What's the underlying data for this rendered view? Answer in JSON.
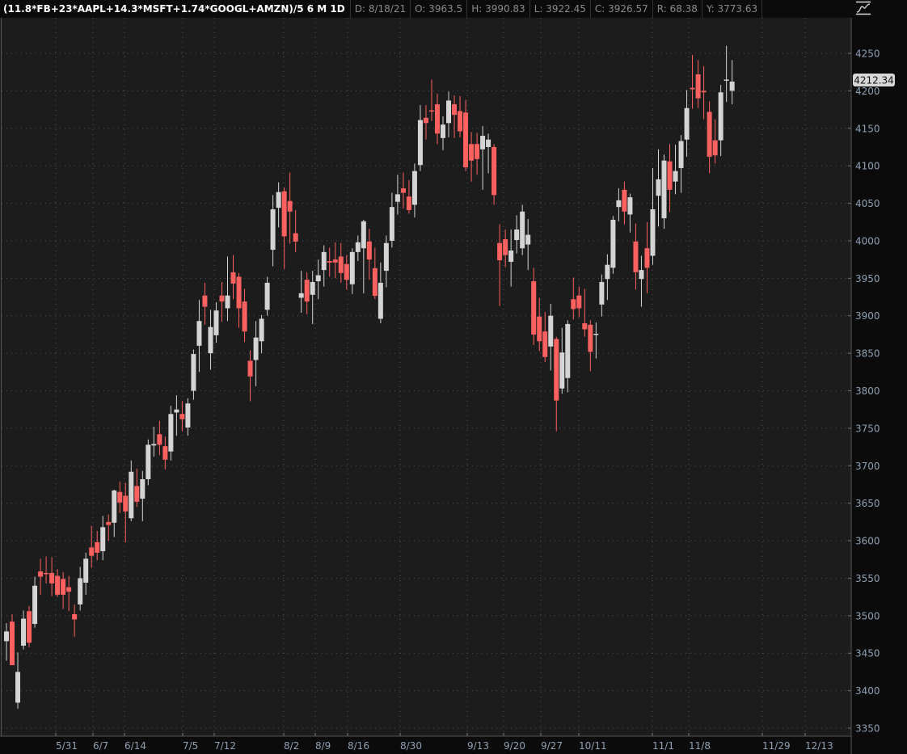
{
  "header": {
    "symbol": "(11.8*FB+23*AAPL+14.3*MSFT+1.74*GOOGL+AMZN)/5 6 M 1D",
    "date": "D: 8/18/21",
    "open": "O: 3963.5",
    "high": "H: 3990.83",
    "low": "L: 3922.45",
    "close": "C: 3926.57",
    "range": "R: 68.38",
    "y": "Y: 3773.63"
  },
  "icons": {
    "style_toggle": "curve-icon"
  },
  "colors": {
    "up": "#d4d4d4",
    "down": "#ff6060",
    "background": "#1c1c1c",
    "grid": "#555555",
    "axis_text": "#8fa0b4"
  },
  "chart_data": {
    "type": "candlestick",
    "title": "(11.8*FB+23*AAPL+14.3*MSFT+1.74*GOOGL+AMZN)/5",
    "ylim": [
      3330,
      4280
    ],
    "yticks": [
      3350,
      3400,
      3450,
      3500,
      3550,
      3600,
      3650,
      3700,
      3750,
      3800,
      3850,
      3900,
      3950,
      4000,
      4050,
      4100,
      4150,
      4200,
      4250
    ],
    "xticks": [
      "5/31",
      "6/7",
      "6/14",
      "7/5",
      "7/12",
      "8/2",
      "8/9",
      "8/16",
      "8/30",
      "9/13",
      "9/20",
      "9/27",
      "10/11",
      "11/1",
      "11/8",
      "11/29",
      "12/13"
    ],
    "last_price": "4212.34",
    "grid": true,
    "ohlc": [
      [
        3466,
        3490,
        3440,
        3479
      ],
      [
        3492,
        3502,
        3434,
        3434
      ],
      [
        3384,
        3451,
        3376,
        3425
      ],
      [
        3460,
        3507,
        3455,
        3496
      ],
      [
        3506,
        3513,
        3458,
        3464
      ],
      [
        3489,
        3552,
        3484,
        3540
      ],
      [
        3559,
        3576,
        3528,
        3552
      ],
      [
        3557,
        3579,
        3543,
        3556
      ],
      [
        3557,
        3578,
        3526,
        3543
      ],
      [
        3553,
        3562,
        3525,
        3528
      ],
      [
        3549,
        3558,
        3509,
        3528
      ],
      [
        3538,
        3553,
        3506,
        3532
      ],
      [
        3502,
        3515,
        3472,
        3495
      ],
      [
        3515,
        3565,
        3507,
        3550
      ],
      [
        3544,
        3584,
        3528,
        3576
      ],
      [
        3591,
        3620,
        3564,
        3580
      ],
      [
        3598,
        3613,
        3574,
        3584
      ],
      [
        3586,
        3633,
        3574,
        3618
      ],
      [
        3625,
        3635,
        3600,
        3621
      ],
      [
        3624,
        3668,
        3605,
        3667
      ],
      [
        3665,
        3679,
        3637,
        3651
      ],
      [
        3660,
        3677,
        3598,
        3639
      ],
      [
        3630,
        3707,
        3626,
        3692
      ],
      [
        3673,
        3696,
        3645,
        3652
      ],
      [
        3656,
        3693,
        3626,
        3682
      ],
      [
        3682,
        3735,
        3674,
        3728
      ],
      [
        3727,
        3752,
        3712,
        3729
      ],
      [
        3742,
        3760,
        3714,
        3728
      ],
      [
        3726,
        3739,
        3695,
        3708
      ],
      [
        3719,
        3780,
        3707,
        3769
      ],
      [
        3771,
        3794,
        3740,
        3775
      ],
      [
        3769,
        3786,
        3746,
        3762
      ],
      [
        3751,
        3790,
        3740,
        3783
      ],
      [
        3800,
        3855,
        3788,
        3849
      ],
      [
        3860,
        3921,
        3825,
        3893
      ],
      [
        3927,
        3944,
        3888,
        3912
      ],
      [
        3850,
        3908,
        3828,
        3885
      ],
      [
        3874,
        3918,
        3864,
        3907
      ],
      [
        3927,
        3945,
        3892,
        3919
      ],
      [
        3910,
        3979,
        3893,
        3927
      ],
      [
        3958,
        3981,
        3922,
        3943
      ],
      [
        3952,
        3957,
        3884,
        3910
      ],
      [
        3919,
        3936,
        3865,
        3879
      ],
      [
        3840,
        3854,
        3786,
        3819
      ],
      [
        3841,
        3893,
        3806,
        3871
      ],
      [
        3866,
        3901,
        3850,
        3896
      ],
      [
        3908,
        3952,
        3900,
        3944
      ],
      [
        3988,
        4061,
        3966,
        4042
      ],
      [
        4044,
        4078,
        4018,
        4065
      ],
      [
        4066,
        4071,
        3962,
        4006
      ],
      [
        4053,
        4091,
        3996,
        4039
      ],
      [
        4010,
        4041,
        3985,
        3999
      ],
      [
        3924,
        3960,
        3904,
        3930
      ],
      [
        3948,
        3958,
        3902,
        3919
      ],
      [
        3928,
        3960,
        3889,
        3945
      ],
      [
        3946,
        3975,
        3922,
        3954
      ],
      [
        3961,
        3994,
        3939,
        3985
      ],
      [
        3973,
        3991,
        3952,
        3971
      ],
      [
        3975,
        3998,
        3950,
        3971
      ],
      [
        3979,
        3997,
        3944,
        3957
      ],
      [
        3969,
        3981,
        3935,
        3948
      ],
      [
        3942,
        3990,
        3929,
        3985
      ],
      [
        3985,
        4007,
        3973,
        3998
      ],
      [
        3990,
        4028,
        3930,
        4026
      ],
      [
        3999,
        4016,
        3948,
        3975
      ],
      [
        3963.5,
        3990.83,
        3922.45,
        3926.57
      ],
      [
        3896,
        3971,
        3890,
        3944
      ],
      [
        3960,
        4007,
        3938,
        3997
      ],
      [
        4000,
        4064,
        3991,
        4045
      ],
      [
        4052,
        4088,
        4035,
        4062
      ],
      [
        4070,
        4091,
        4043,
        4064
      ],
      [
        4059,
        4081,
        4036,
        4041
      ],
      [
        4048,
        4103,
        4031,
        4093
      ],
      [
        4101,
        4181,
        4093,
        4161
      ],
      [
        4164,
        4181,
        4135,
        4157
      ],
      [
        4174,
        4215,
        4160,
        4173
      ],
      [
        4182,
        4196,
        4129,
        4143
      ],
      [
        4137,
        4166,
        4121,
        4155
      ],
      [
        4157,
        4199,
        4138,
        4187
      ],
      [
        4182,
        4194,
        4137,
        4168
      ],
      [
        4173,
        4193,
        4138,
        4146
      ],
      [
        4171,
        4188,
        4093,
        4098
      ],
      [
        4129,
        4145,
        4079,
        4107
      ],
      [
        4129,
        4144,
        4088,
        4109
      ],
      [
        4122,
        4153,
        4068,
        4140
      ],
      [
        4125,
        4143,
        4090,
        4135
      ],
      [
        4125,
        4129,
        4048,
        4061
      ],
      [
        3997,
        4022,
        3913,
        3974
      ],
      [
        4002,
        4015,
        3965,
        3981
      ],
      [
        3972,
        4015,
        3939,
        3987
      ],
      [
        4001,
        4034,
        3983,
        4015
      ],
      [
        3990,
        4048,
        3981,
        4039
      ],
      [
        3995,
        4029,
        3961,
        4008
      ],
      [
        3946,
        3964,
        3861,
        3875
      ],
      [
        3899,
        3924,
        3853,
        3866
      ],
      [
        3879,
        3905,
        3838,
        3845
      ],
      [
        3859,
        3916,
        3827,
        3900
      ],
      [
        3869,
        3872,
        3746,
        3787
      ],
      [
        3803,
        3884,
        3796,
        3851
      ],
      [
        3817,
        3894,
        3798,
        3889
      ],
      [
        3922,
        3951,
        3895,
        3909
      ],
      [
        3927,
        3939,
        3898,
        3910
      ],
      [
        3890,
        3936,
        3872,
        3882
      ],
      [
        3888,
        3894,
        3826,
        3852
      ],
      [
        3875,
        3891,
        3843,
        3876
      ],
      [
        3915,
        3955,
        3899,
        3945
      ],
      [
        3949,
        3982,
        3921,
        3968
      ],
      [
        3964,
        4033,
        3956,
        4028
      ],
      [
        4045,
        4070,
        4026,
        4054
      ],
      [
        4068,
        4079,
        4022,
        4039
      ],
      [
        4035,
        4063,
        4011,
        4058
      ],
      [
        3999,
        4023,
        3935,
        3958
      ],
      [
        3949,
        3980,
        3912,
        3961
      ],
      [
        3990,
        4025,
        3930,
        3964
      ],
      [
        3980,
        4097,
        3968,
        4042
      ],
      [
        4060,
        4122,
        4019,
        4082
      ],
      [
        4030,
        4115,
        4016,
        4107
      ],
      [
        4106,
        4129,
        4038,
        4068
      ],
      [
        4079,
        4128,
        4062,
        4093
      ],
      [
        4097,
        4141,
        4064,
        4133
      ],
      [
        4135,
        4201,
        4112,
        4177
      ],
      [
        4204,
        4248,
        4176,
        4202
      ],
      [
        4222,
        4241,
        4177,
        4190
      ],
      [
        4200,
        4233,
        4162,
        4198
      ],
      [
        4172,
        4186,
        4090,
        4112
      ],
      [
        4134,
        4162,
        4103,
        4114
      ],
      [
        4134,
        4208,
        4113,
        4198
      ],
      [
        4214,
        4260,
        4185,
        4215
      ],
      [
        4200,
        4241,
        4182,
        4212.34
      ]
    ]
  }
}
